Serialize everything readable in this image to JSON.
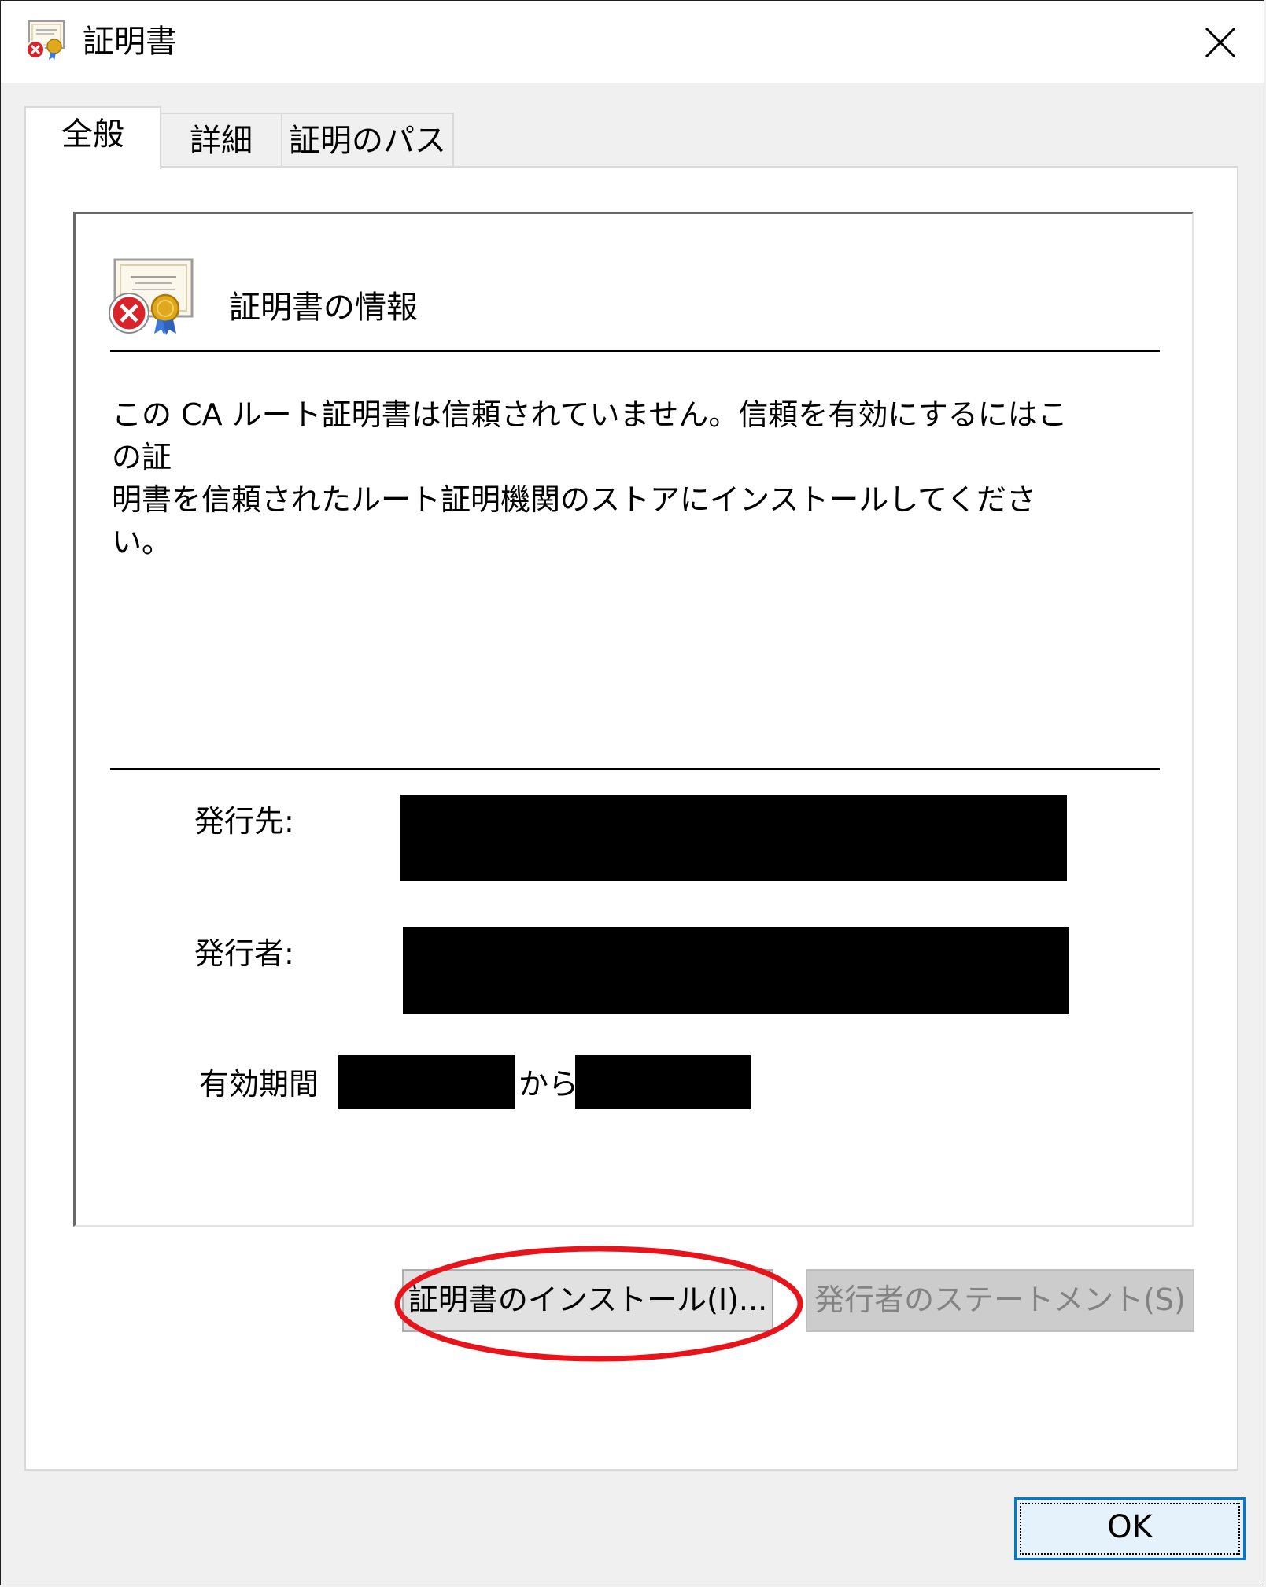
{
  "window": {
    "title": "証明書",
    "close_glyph": "✕"
  },
  "tabs": [
    {
      "label": "全般",
      "active": true
    },
    {
      "label": "詳細",
      "active": false
    },
    {
      "label": "証明のパス",
      "active": false
    }
  ],
  "info": {
    "heading": "証明書の情報",
    "message_line1": "この CA ルート証明書は信頼されていません。信頼を有効にするにはこの証",
    "message_line2": "明書を信頼されたルート証明機関のストアにインストールしてください。"
  },
  "fields": {
    "issued_to_label": "発行先:",
    "issued_by_label": "発行者:",
    "validity_label": "有効期間",
    "validity_from_connector": "から"
  },
  "buttons": {
    "install_label": "証明書のインストール(I)...",
    "statement_label": "発行者のステートメント(S)",
    "ok_label": "OK"
  },
  "colors": {
    "highlight_ring": "#e8141c",
    "error_badge": "#d8232a",
    "seal_gold": "#e0a91c",
    "focus_blue": "#0078d7"
  },
  "icons": {
    "title_icon": "certificate-error-icon",
    "info_icon": "certificate-error-icon",
    "close_icon": "close-icon"
  }
}
